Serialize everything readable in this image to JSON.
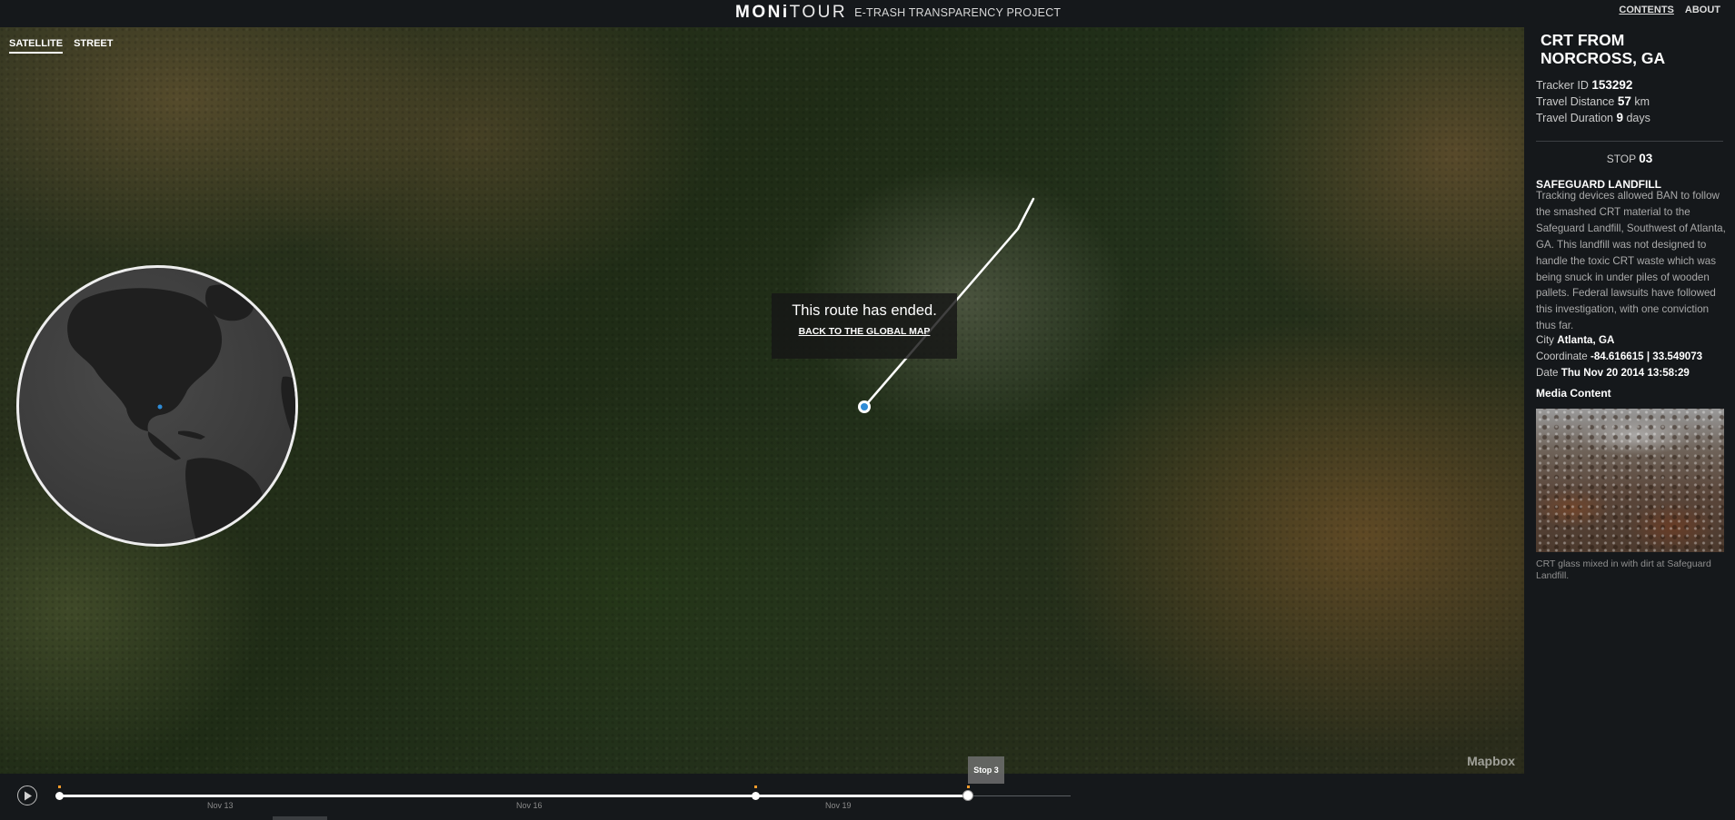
{
  "header": {
    "logo_bold": "MONi",
    "logo_light": "TOUR",
    "tagline": "E-TRASH TRANSPARENCY PROJECT",
    "nav": {
      "contents": "CONTENTS",
      "about": "ABOUT"
    }
  },
  "map": {
    "toggle": {
      "satellite": "SATELLITE",
      "street": "STREET"
    },
    "route_ended": {
      "message": "This route has ended.",
      "link": "BACK TO THE GLOBAL MAP"
    },
    "attribution": "Mapbox"
  },
  "panel": {
    "title": "CRT FROM NORCROSS, GA",
    "tracker_label": "Tracker ID",
    "tracker_id": "153292",
    "distance_label": "Travel Distance",
    "distance_value": "57",
    "distance_unit": "km",
    "duration_label": "Travel Duration",
    "duration_value": "9",
    "duration_unit": "days",
    "stop_label": "STOP",
    "stop_number": "03",
    "site_name": "SAFEGUARD LANDFILL",
    "description": "Tracking devices allowed BAN to follow the smashed CRT material to the Safeguard Landfill, Southwest of Atlanta, GA. This landfill was not designed to handle the toxic CRT waste which was being snuck in under piles of wooden pallets. Federal lawsuits have followed this investigation, with one conviction thus far.",
    "city_label": "City",
    "city_value": "Atlanta, GA",
    "coordinate_label": "Coordinate",
    "coordinate_value": "-84.616615 | 33.549073",
    "date_label": "Date",
    "date_value": "Thu Nov 20 2014 13:58:29",
    "media_label": "Media Content",
    "media_caption": "CRT glass mixed in with dirt at Safeguard Landfill."
  },
  "timeline": {
    "labels": [
      "Nov 13",
      "Nov 16",
      "Nov 19"
    ],
    "stop_bubble": "Stop 3",
    "progress": 0.87
  },
  "colors": {
    "background": "#15181b",
    "route": "#ffffff",
    "marker": "#2e8bd6",
    "event_mark": "#ff9c2a"
  },
  "icons": [
    "play-icon",
    "location-marker-icon"
  ]
}
